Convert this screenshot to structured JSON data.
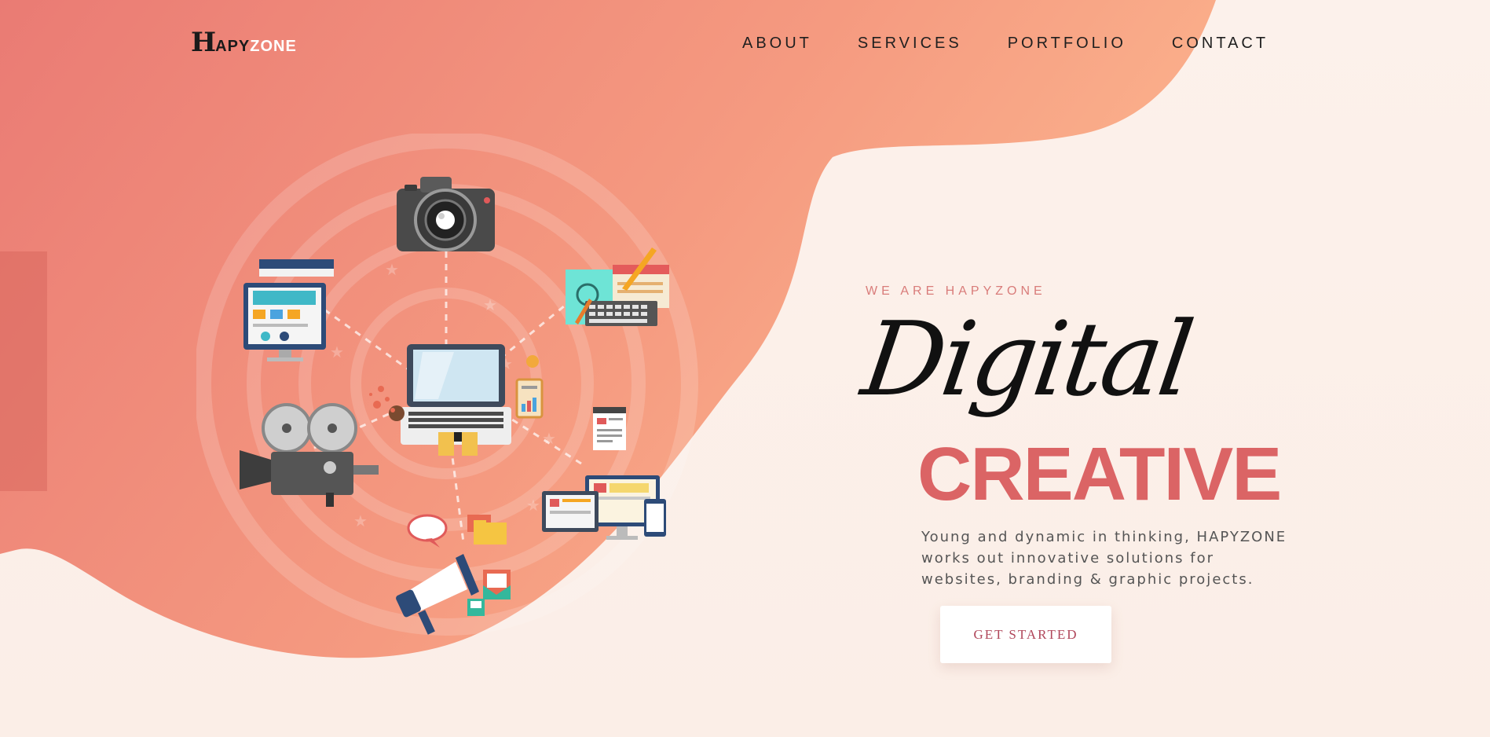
{
  "brand": {
    "logo_h": "H",
    "logo_apy": "APY",
    "logo_zone": "ZONE"
  },
  "nav": {
    "items": [
      "ABOUT",
      "SERVICES",
      "PORTFOLIO",
      "CONTACT"
    ]
  },
  "hero": {
    "eyebrow": "WE ARE HAPYZONE",
    "script_title": "Digital",
    "headline": "CREATIVE",
    "description": "Young and dynamic in thinking, HAPYZONE works out innovative solutions for websites, branding & graphic projects.",
    "cta_label": "GET STARTED"
  },
  "colors": {
    "blob_start": "#ea7b74",
    "blob_end": "#fcb58e",
    "accent": "#db6465",
    "eyebrow": "#d97c7a",
    "cta_text": "#b0465a"
  },
  "illustration": {
    "icons": [
      "camera-icon",
      "web-design-monitor-icon",
      "graphic-design-icon",
      "laptop-icon",
      "film-projector-icon",
      "responsive-devices-icon",
      "megaphone-icon",
      "folder-icon",
      "email-icon",
      "document-icon",
      "speech-bubble-icon",
      "coffee-cup-icon",
      "clipboard-chart-icon"
    ]
  }
}
